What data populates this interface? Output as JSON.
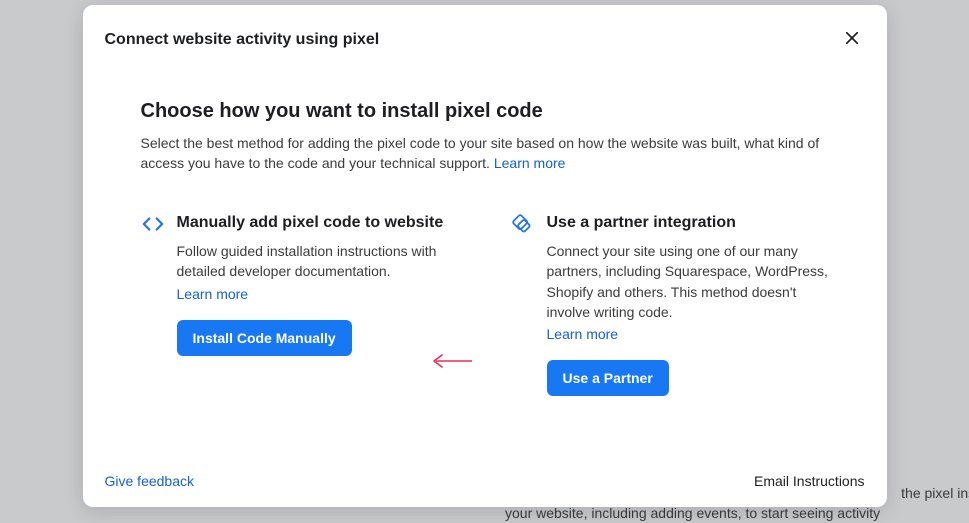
{
  "modal": {
    "title": "Connect website activity using pixel",
    "heading": "Choose how you want to install pixel code",
    "sub": "Select the best method for adding the pixel code to your site based on how the website was built, what kind of access you have to the code and your technical support. ",
    "learn_more": "Learn more"
  },
  "options": {
    "manual": {
      "title": "Manually add pixel code to website",
      "desc": "Follow guided installation instructions with detailed developer documentation.",
      "learn_more": "Learn more",
      "cta": "Install Code Manually"
    },
    "partner": {
      "title": "Use a partner integration",
      "desc": "Connect your site using one of our many partners, including Squarespace, WordPress, Shopify and others. This method doesn't involve writing code.",
      "learn_more": "Learn more",
      "cta": "Use a Partner"
    }
  },
  "footer": {
    "feedback": "Give feedback",
    "email": "Email Instructions"
  },
  "backdrop": {
    "line1": "the pixel inst",
    "line2": "your website, including adding events, to start seeing activity"
  }
}
